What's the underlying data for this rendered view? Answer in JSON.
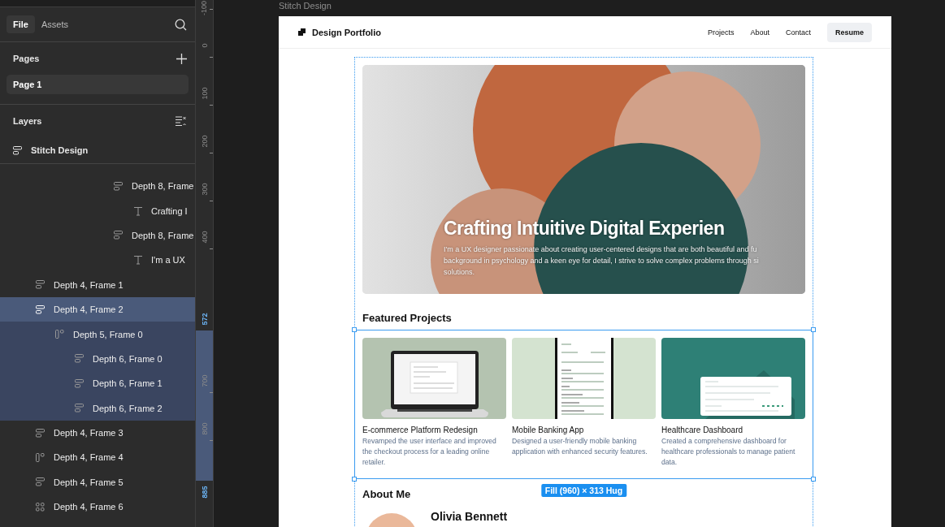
{
  "sidebar": {
    "tabs": [
      {
        "label": "File",
        "selected": true
      },
      {
        "label": "Assets",
        "selected": false
      }
    ],
    "pages": {
      "title": "Pages",
      "items": [
        {
          "label": "Page 1",
          "selected": true
        }
      ]
    },
    "layers": {
      "title": "Layers",
      "root": {
        "label": "Stitch Design",
        "kind": "vstack"
      },
      "clipped_rows": [
        {
          "label": "Depth 8, Frame",
          "kind": "vstack",
          "selected": false,
          "children": [
            {
              "label": "Crafting I",
              "kind": "text",
              "selected": false
            }
          ]
        },
        {
          "label": "Depth 8, Frame",
          "kind": "vstack",
          "selected": false,
          "children": [
            {
              "label": "I'm a UX",
              "kind": "text",
              "selected": false
            }
          ]
        }
      ],
      "rows": [
        {
          "label": "Depth 4, Frame 1",
          "kind": "vstack",
          "selected": false
        },
        {
          "label": "Depth 4, Frame 2",
          "kind": "vstack",
          "selected": true,
          "children": [
            {
              "label": "Depth 5, Frame 0",
              "kind": "hstack",
              "selected": false,
              "children": [
                {
                  "label": "Depth 6, Frame 0",
                  "kind": "vstack",
                  "selected": false
                },
                {
                  "label": "Depth 6, Frame 1",
                  "kind": "vstack",
                  "selected": false
                },
                {
                  "label": "Depth 6, Frame 2",
                  "kind": "vstack",
                  "selected": false
                }
              ]
            }
          ]
        },
        {
          "label": "Depth 4, Frame 3",
          "kind": "vstack",
          "selected": false
        },
        {
          "label": "Depth 4, Frame 4",
          "kind": "hstack",
          "selected": false
        },
        {
          "label": "Depth 4, Frame 5",
          "kind": "vstack",
          "selected": false
        },
        {
          "label": "Depth 4, Frame 6",
          "kind": "grid",
          "selected": false
        }
      ]
    }
  },
  "ruler": {
    "marks": [
      {
        "label": "-100",
        "kind": "tick"
      },
      {
        "label": "0",
        "kind": "tick"
      },
      {
        "label": "100",
        "kind": "tick"
      },
      {
        "label": "200",
        "kind": "tick"
      },
      {
        "label": "300",
        "kind": "tick"
      },
      {
        "label": "400",
        "kind": "tick"
      },
      {
        "label": "572",
        "kind": "edge"
      },
      {
        "label": "700",
        "kind": "tick"
      },
      {
        "label": "800",
        "kind": "tick"
      },
      {
        "label": "885",
        "kind": "edge"
      }
    ]
  },
  "canvas": {
    "frame_label": "Stitch Design",
    "site": {
      "brand": "Design Portfolio",
      "nav": [
        "Projects",
        "About",
        "Contact"
      ],
      "cta": "Resume",
      "hero": {
        "title": "Crafting Intuitive Digital Experien",
        "lines": [
          "I'm a UX designer passionate about creating user-centered designs that are both beautiful and fu",
          "background in psychology and a keen eye for detail, I strive to solve complex problems through si",
          "solutions."
        ]
      },
      "featured_title": "Featured Projects",
      "projects": [
        {
          "kind": "laptop",
          "title": "E-commerce Platform Redesign",
          "description": "Revamped the user interface and improved the checkout process for a leading online retailer."
        },
        {
          "kind": "phone",
          "title": "Mobile Banking App",
          "description": "Designed a user-friendly mobile banking application with enhanced security features."
        },
        {
          "kind": "dashboard",
          "title": "Healthcare Dashboard",
          "description": "Created a comprehensive dashboard for healthcare professionals to manage patient data."
        }
      ],
      "size_badge": "Fill (960) × 313 Hug",
      "about_title": "About Me",
      "name": "Olivia Bennett"
    }
  }
}
